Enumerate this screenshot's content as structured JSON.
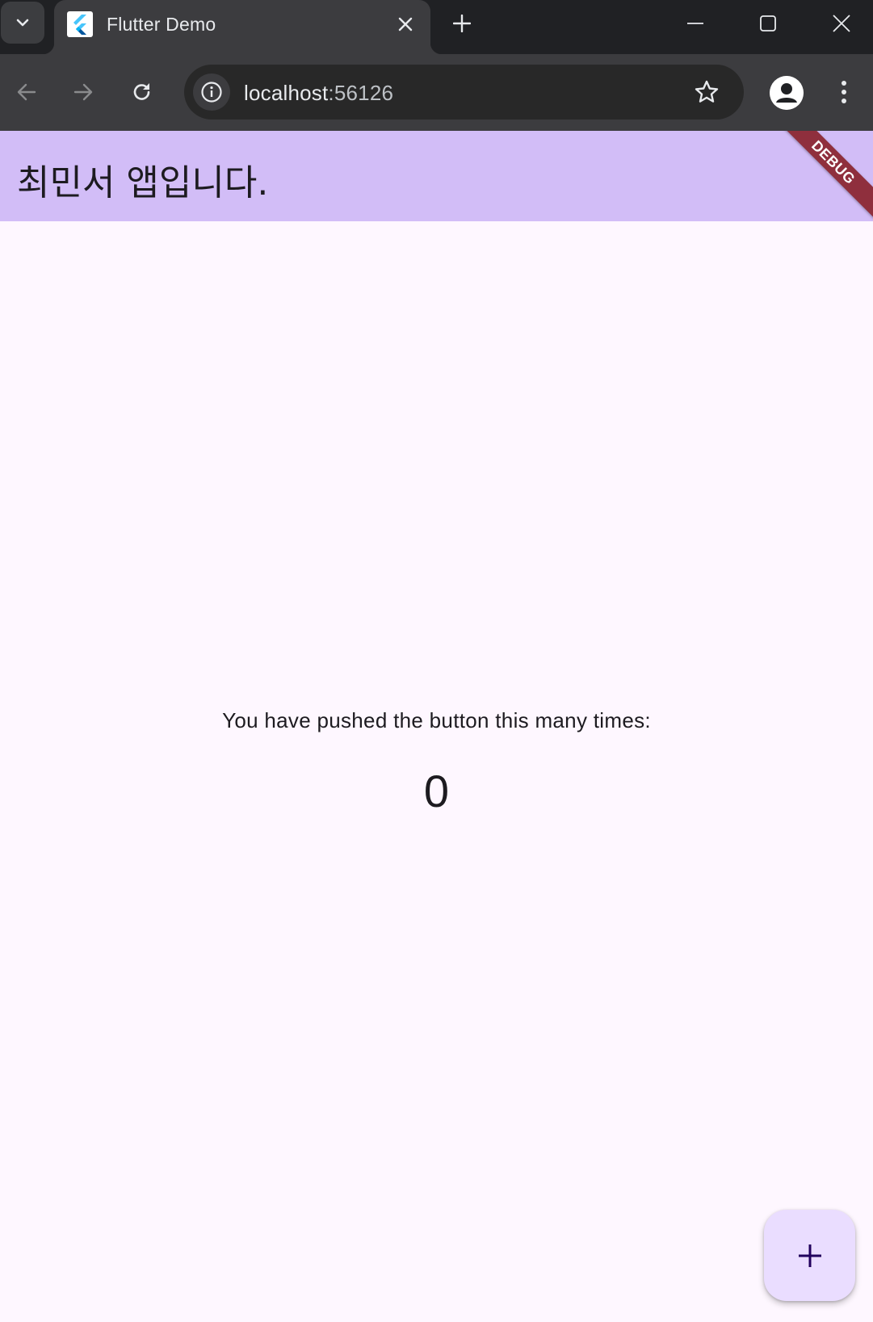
{
  "browser": {
    "tab": {
      "title": "Flutter Demo"
    },
    "address_bar": {
      "host": "localhost",
      "port": ":56126"
    }
  },
  "icons": {
    "tab_search": "chevron-down-icon",
    "favicon": "flutter-logo-icon",
    "tab_close": "close-icon",
    "new_tab": "plus-icon",
    "minimize": "minimize-icon",
    "maximize": "maximize-icon",
    "window_close": "close-icon",
    "back": "arrow-left-icon",
    "forward": "arrow-right-icon",
    "reload": "reload-icon",
    "site_info": "info-icon",
    "bookmark": "star-icon",
    "profile": "person-icon",
    "menu": "more-vert-icon",
    "fab": "plus-icon"
  },
  "app": {
    "title": "최민서 앱입니다.",
    "debug_banner": "DEBUG",
    "counter_label": "You have pushed the button this many times:",
    "counter_value": "0"
  },
  "colors": {
    "appbar": "#d2bdf7",
    "page_background": "#fef7ff",
    "fab_background": "#eaddff",
    "debug_banner": "#8f2f3d",
    "browser_frame": "#202124",
    "browser_toolbar": "#3c3c3f"
  }
}
